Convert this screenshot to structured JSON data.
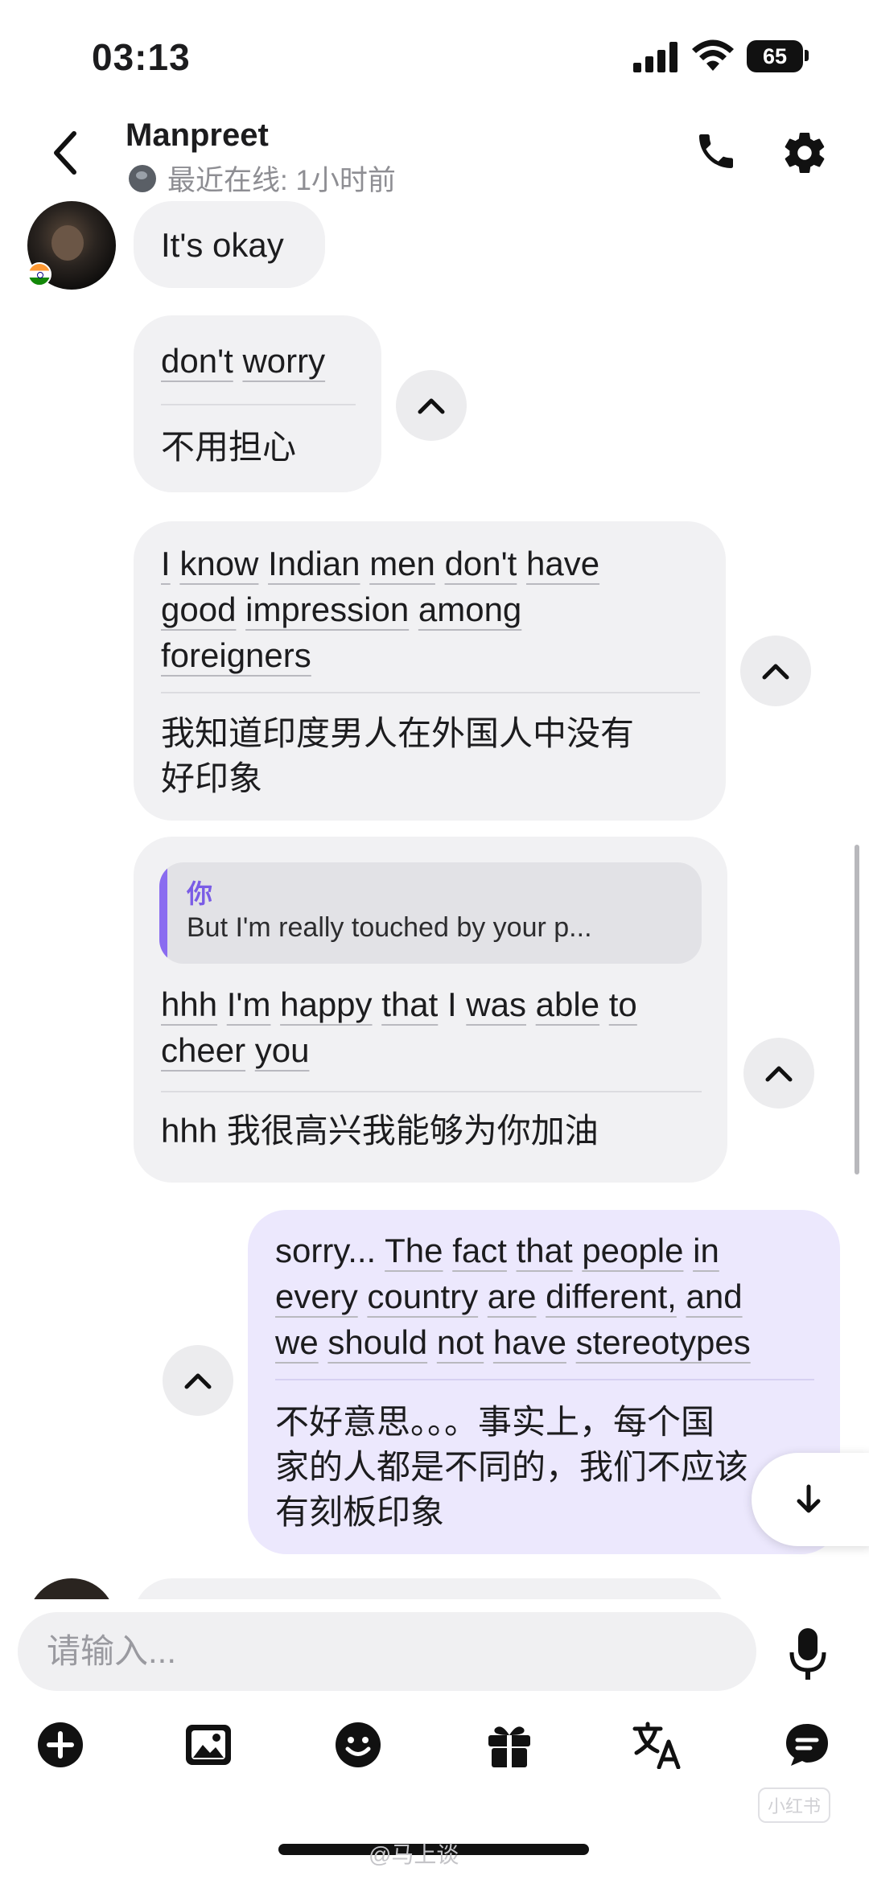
{
  "status_bar": {
    "time": "03:13",
    "battery": "65"
  },
  "header": {
    "name": "Manpreet",
    "last_seen": "最近在线: 1小时前"
  },
  "messages": [
    {
      "sender": "them",
      "text": "It's okay"
    },
    {
      "sender": "them",
      "text_words": [
        "don't",
        "worry"
      ],
      "translation": "不用担心"
    },
    {
      "sender": "them",
      "lines": [
        [
          "I",
          "know",
          "Indian",
          "men",
          "don't",
          "have"
        ],
        [
          "good",
          "impression",
          "among"
        ],
        [
          "foreigners"
        ]
      ],
      "translation_lines": [
        "我知道印度男人在外国人中没有",
        "好印象"
      ]
    },
    {
      "sender": "them",
      "quote": {
        "author": "你",
        "text": "But I'm really touched by your p..."
      },
      "lines": [
        [
          "hhh",
          "I'm",
          "happy",
          "that",
          "I",
          "was",
          "able",
          "to"
        ],
        [
          "cheer",
          "you"
        ]
      ],
      "translation_lines": [
        "hhh 我很高兴我能够为你加油"
      ]
    },
    {
      "sender": "me",
      "lines": [
        [
          "sorry...",
          "The",
          "fact",
          "that",
          "people",
          "in"
        ],
        [
          "every",
          "country",
          "are",
          "different,",
          "and"
        ],
        [
          "we",
          "should",
          "not",
          "have",
          "stereotypes"
        ]
      ],
      "translation_lines": [
        "不好意思。。。事实上，每个国",
        "家的人都是不同的，我们不应该",
        "有刻板印象"
      ]
    }
  ],
  "composer": {
    "placeholder": "请输入..."
  },
  "toolbar": [
    "add-icon",
    "photo-icon",
    "emoji-icon",
    "gift-icon",
    "translate-icon",
    "chat-icon"
  ],
  "watermarks": {
    "corner": "小红书",
    "weibo": "@马上谈"
  },
  "colors": {
    "bubble_them": "#f1f1f3",
    "bubble_me": "#ece8fd",
    "quote_accent": "#8a6cf0"
  }
}
